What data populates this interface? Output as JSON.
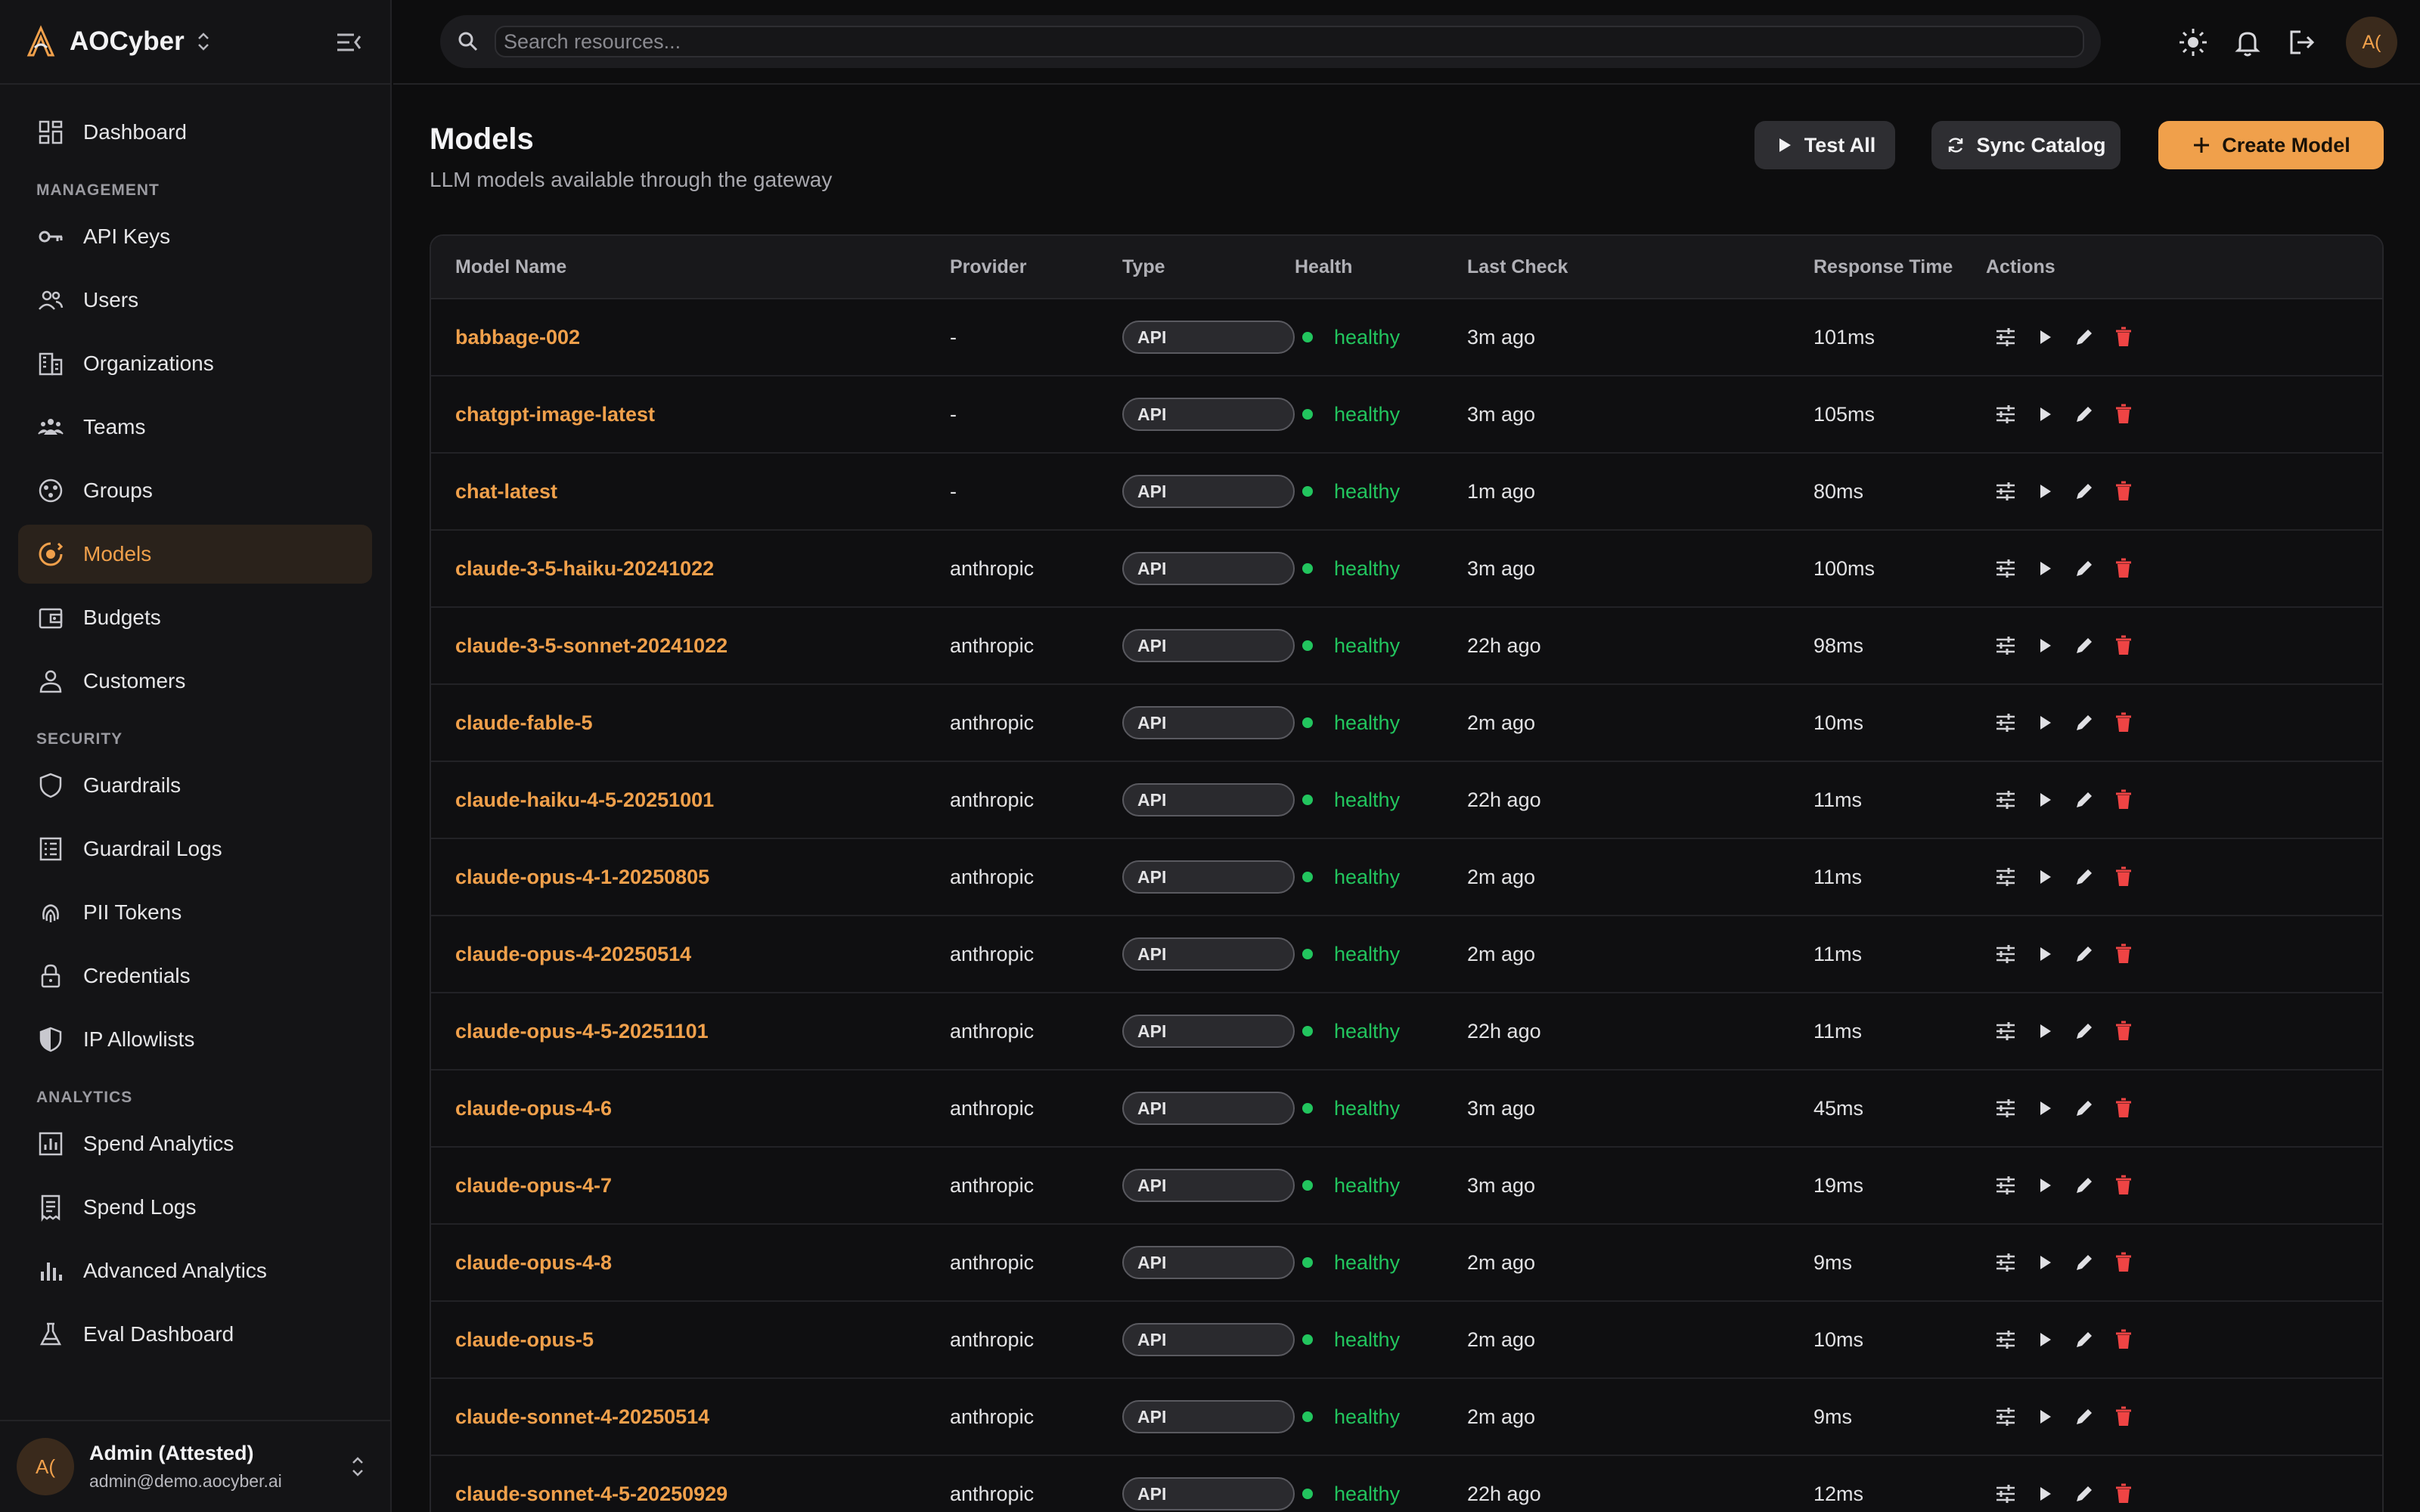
{
  "brand": {
    "name": "AOCyber"
  },
  "sidebar": {
    "items": [
      {
        "label": "Dashboard",
        "icon": "dashboard-icon",
        "active": false
      },
      {
        "section": "MANAGEMENT"
      },
      {
        "label": "API Keys",
        "icon": "key-icon",
        "active": false
      },
      {
        "label": "Users",
        "icon": "users-icon",
        "active": false
      },
      {
        "label": "Organizations",
        "icon": "building-icon",
        "active": false
      },
      {
        "label": "Teams",
        "icon": "team-icon",
        "active": false
      },
      {
        "label": "Groups",
        "icon": "groups-icon",
        "active": false
      },
      {
        "label": "Models",
        "icon": "model-icon",
        "active": true
      },
      {
        "label": "Budgets",
        "icon": "wallet-icon",
        "active": false
      },
      {
        "label": "Customers",
        "icon": "person-icon",
        "active": false
      },
      {
        "section": "SECURITY"
      },
      {
        "label": "Guardrails",
        "icon": "shield-icon",
        "active": false
      },
      {
        "label": "Guardrail Logs",
        "icon": "list-icon",
        "active": false
      },
      {
        "label": "PII Tokens",
        "icon": "fingerprint-icon",
        "active": false
      },
      {
        "label": "Credentials",
        "icon": "lock-icon",
        "active": false
      },
      {
        "label": "IP Allowlists",
        "icon": "shield-half-icon",
        "active": false
      },
      {
        "section": "ANALYTICS"
      },
      {
        "label": "Spend Analytics",
        "icon": "chart-icon",
        "active": false
      },
      {
        "label": "Spend Logs",
        "icon": "receipt-icon",
        "active": false
      },
      {
        "label": "Advanced Analytics",
        "icon": "bar-chart-icon",
        "active": false
      },
      {
        "label": "Eval Dashboard",
        "icon": "flask-icon",
        "active": false
      }
    ]
  },
  "user": {
    "initials": "A(",
    "name": "Admin (Attested)",
    "email": "admin@demo.aocyber.ai"
  },
  "search": {
    "placeholder": "Search resources..."
  },
  "topbar": {
    "avatar_initials": "A("
  },
  "page": {
    "title": "Models",
    "subtitle": "LLM models available through the gateway"
  },
  "buttons": {
    "test_all": "Test All",
    "sync_catalog": "Sync Catalog",
    "create_model": "Create Model"
  },
  "table": {
    "columns": [
      "Model Name",
      "Provider",
      "Type",
      "Health",
      "Last Check",
      "Response Time",
      "Actions"
    ],
    "rows": [
      {
        "name": "babbage-002",
        "provider": "-",
        "type": "API",
        "health": "healthy",
        "last_check": "3m ago",
        "response": "101ms"
      },
      {
        "name": "chatgpt-image-latest",
        "provider": "-",
        "type": "API",
        "health": "healthy",
        "last_check": "3m ago",
        "response": "105ms"
      },
      {
        "name": "chat-latest",
        "provider": "-",
        "type": "API",
        "health": "healthy",
        "last_check": "1m ago",
        "response": "80ms"
      },
      {
        "name": "claude-3-5-haiku-20241022",
        "provider": "anthropic",
        "type": "API",
        "health": "healthy",
        "last_check": "3m ago",
        "response": "100ms"
      },
      {
        "name": "claude-3-5-sonnet-20241022",
        "provider": "anthropic",
        "type": "API",
        "health": "healthy",
        "last_check": "22h ago",
        "response": "98ms"
      },
      {
        "name": "claude-fable-5",
        "provider": "anthropic",
        "type": "API",
        "health": "healthy",
        "last_check": "2m ago",
        "response": "10ms"
      },
      {
        "name": "claude-haiku-4-5-20251001",
        "provider": "anthropic",
        "type": "API",
        "health": "healthy",
        "last_check": "22h ago",
        "response": "11ms"
      },
      {
        "name": "claude-opus-4-1-20250805",
        "provider": "anthropic",
        "type": "API",
        "health": "healthy",
        "last_check": "2m ago",
        "response": "11ms"
      },
      {
        "name": "claude-opus-4-20250514",
        "provider": "anthropic",
        "type": "API",
        "health": "healthy",
        "last_check": "2m ago",
        "response": "11ms"
      },
      {
        "name": "claude-opus-4-5-20251101",
        "provider": "anthropic",
        "type": "API",
        "health": "healthy",
        "last_check": "22h ago",
        "response": "11ms"
      },
      {
        "name": "claude-opus-4-6",
        "provider": "anthropic",
        "type": "API",
        "health": "healthy",
        "last_check": "3m ago",
        "response": "45ms"
      },
      {
        "name": "claude-opus-4-7",
        "provider": "anthropic",
        "type": "API",
        "health": "healthy",
        "last_check": "3m ago",
        "response": "19ms"
      },
      {
        "name": "claude-opus-4-8",
        "provider": "anthropic",
        "type": "API",
        "health": "healthy",
        "last_check": "2m ago",
        "response": "9ms"
      },
      {
        "name": "claude-opus-5",
        "provider": "anthropic",
        "type": "API",
        "health": "healthy",
        "last_check": "2m ago",
        "response": "10ms"
      },
      {
        "name": "claude-sonnet-4-20250514",
        "provider": "anthropic",
        "type": "API",
        "health": "healthy",
        "last_check": "2m ago",
        "response": "9ms"
      },
      {
        "name": "claude-sonnet-4-5-20250929",
        "provider": "anthropic",
        "type": "API",
        "health": "healthy",
        "last_check": "22h ago",
        "response": "12ms"
      }
    ]
  },
  "colors": {
    "accent": "#f0a04b",
    "healthy": "#22c55e",
    "danger": "#ef4444"
  }
}
